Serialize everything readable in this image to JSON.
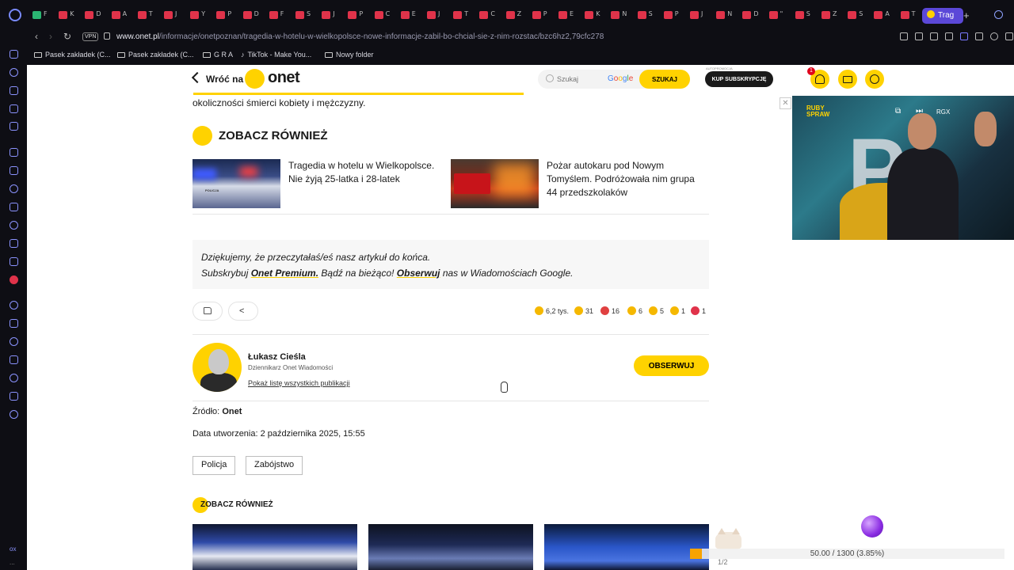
{
  "browser": {
    "tab_letters": [
      "F",
      "K",
      "D",
      "A",
      "T",
      "J",
      "Y",
      "P",
      "D",
      "F",
      "S",
      "J",
      "P",
      "C",
      "E",
      "J",
      "T",
      "C",
      "Z",
      "P",
      "E",
      "K",
      "N",
      "S",
      "P",
      "J",
      "N",
      "D",
      "\"",
      "S",
      "Z",
      "S",
      "A",
      "T"
    ],
    "active_tab_label": "Trag",
    "vpn_label": "VPN",
    "url_host": "www.onet.pl",
    "url_path": "/informacje/onetpoznan/tragedia-w-hotelu-w-wielkopolsce-nowe-informacje-zabil-bo-chcial-sie-z-nim-rozstac/bzc6hz2,79cfc278",
    "bookmarks": [
      "Pasek zakładek (C...",
      "Pasek zakładek (C...",
      "G R A",
      "TikTok - Make You...",
      "Nowy folder"
    ],
    "sidebar_bottom_label": "ox",
    "sidebar_more": "..."
  },
  "header": {
    "back_label": "Wróć na",
    "logo_text": "onet",
    "search_placeholder": "Szukaj",
    "search_engine": "Google",
    "search_button": "SZUKAJ",
    "ad_tag": "AUTOPROMOCJA",
    "subscribe_button": "KUP SUBSKRYPCJĘ",
    "notification_count": "1",
    "reading_progress": 0.49
  },
  "article": {
    "lead_tail": "okoliczności śmierci kobiety i mężczyzny.",
    "see_also_title": "ZOBACZ RÓWNIEŻ",
    "related": [
      {
        "title": "Tragedia w hotelu w Wielkopolsce. Nie żyją 25-latka i 28-latek",
        "thumb_label": "POLICJA"
      },
      {
        "title": "Pożar autokaru pod Nowym Tomyślem. Podróżowała nim grupa 44 przedszkolaków",
        "thumb_label": ""
      }
    ],
    "thanks": {
      "line1": "Dziękujemy, że przeczytałaś/eś nasz artykuł do końca.",
      "line2_a": "Subskrybuj ",
      "line2_link1": "Onet Premium.",
      "line2_b": " Bądź na bieżąco! ",
      "line2_link2": "Obserwuj",
      "line2_c": " nas w Wiadomościach Google."
    },
    "reactions": [
      {
        "count": "6,2 tys.",
        "color": "#f5b800"
      },
      {
        "count": "31",
        "color": "#f5b800"
      },
      {
        "count": "16",
        "color": "#e04040"
      },
      {
        "count": "6",
        "color": "#f5b800"
      },
      {
        "count": "5",
        "color": "#f5b800"
      },
      {
        "count": "1",
        "color": "#f5b800"
      },
      {
        "count": "1",
        "color": "#e0334a"
      }
    ],
    "author": {
      "name": "Łukasz Cieśla",
      "role": "Dziennikarz Onet Wiadomości",
      "link": "Pokaż listę wszystkich publikacji",
      "follow_button": "OBSERWUJ"
    },
    "source_label": "Źródło:",
    "source_value": "Onet",
    "created_label": "Data utworzenia:",
    "created_value": "2 października 2025, 15:55",
    "tags": [
      "Policja",
      "Zabójstwo"
    ],
    "see_also_small": "ZOBACZ RÓWNIEŻ"
  },
  "video": {
    "logo_line1": "RUBY",
    "logo_line2": "SPRAW",
    "ctrl_label": "RGX",
    "close_glyph": "✕",
    "big_letter": "P"
  },
  "overlays": {
    "download_text": "50.00 / 1300 (3.85%)",
    "download_fraction": 0.0385,
    "download_caption": "1/2"
  },
  "colors": {
    "brand_yellow": "#ffd200",
    "chrome_bg": "#0e0e14",
    "opera_accent": "#5b48d8"
  }
}
